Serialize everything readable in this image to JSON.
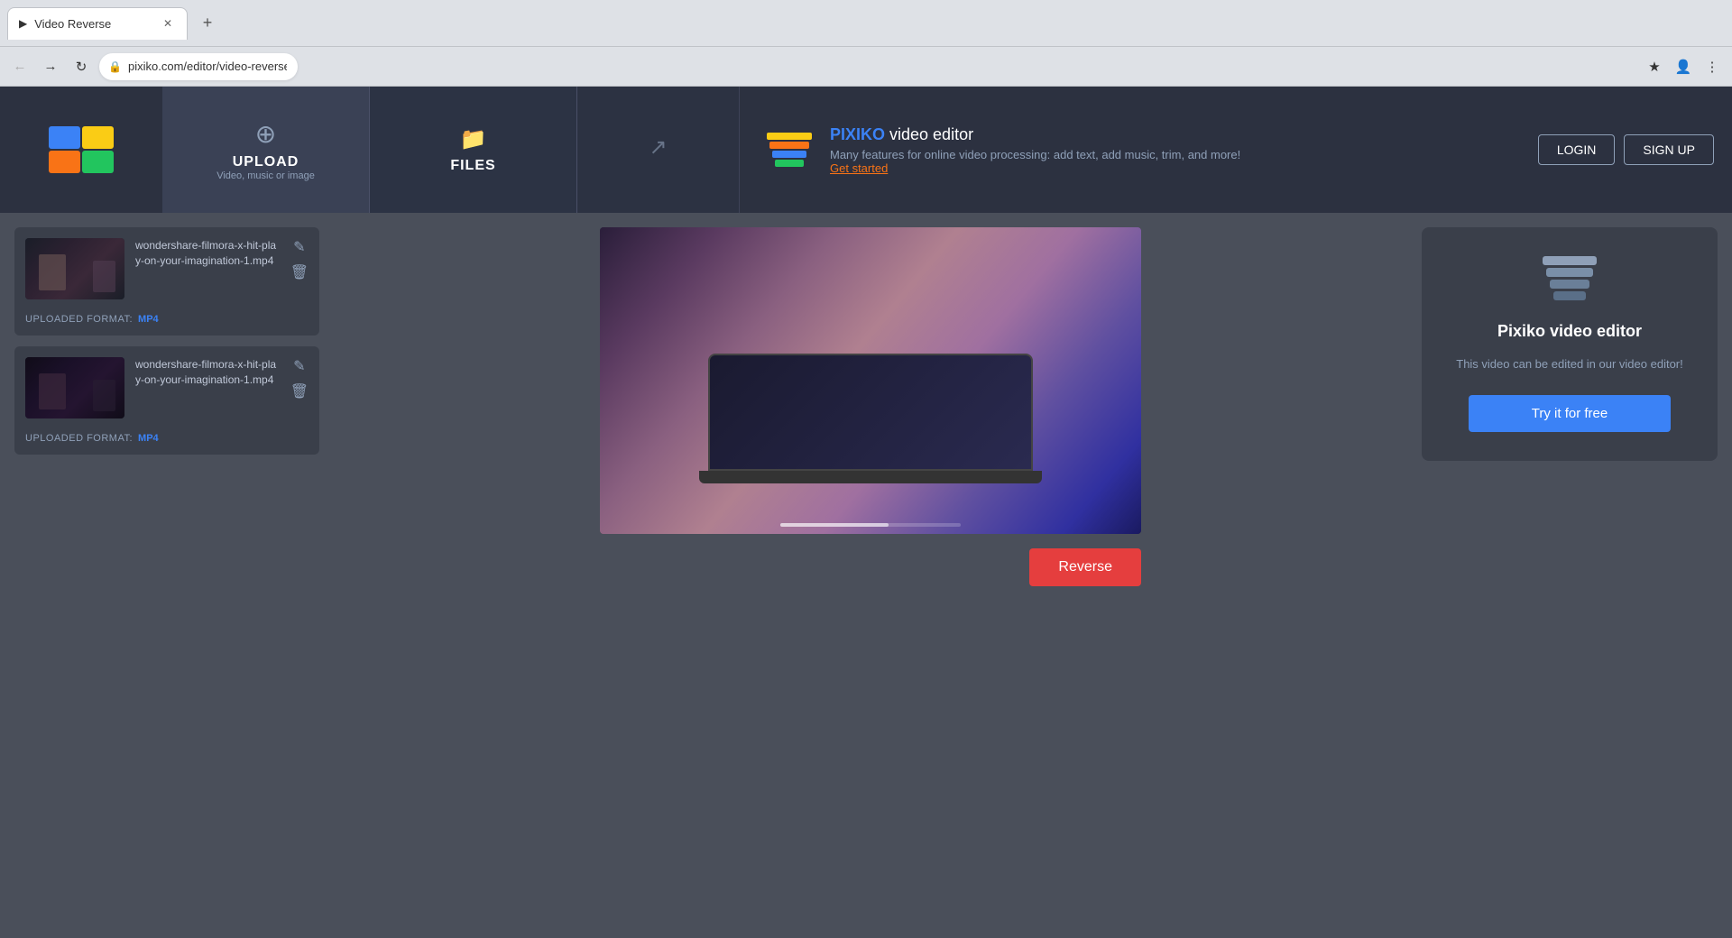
{
  "browser": {
    "tab_title": "Video Reverse",
    "address": "pixiko.com/editor/video-reverse",
    "favicon": "▶"
  },
  "header": {
    "upload_label": "UPLOAD",
    "upload_sublabel": "Video, music or image",
    "files_label": "FILES",
    "promo_brand": "PIXIKO",
    "promo_title_rest": " video editor",
    "promo_desc": "Many features for online video processing: add text, add music, trim, and more!",
    "promo_link": "Get started",
    "login_label": "LOGIN",
    "signup_label": "SIGN UP"
  },
  "sidebar": {
    "file1": {
      "name": "wondershare-filmora-x-hit-play-on-your-imagination-1.mp4",
      "format_label": "UPLOADED FORMAT:",
      "format_value": "MP4"
    },
    "file2": {
      "name": "wondershare-filmora-x-hit-play-on-your-imagination-1.mp4",
      "format_label": "UPLOADED FORMAT:",
      "format_value": "MP4"
    }
  },
  "video": {
    "reverse_button": "Reverse"
  },
  "right_panel": {
    "editor_title": "Pixiko video editor",
    "editor_desc": "This video can be edited in our video editor!",
    "try_free_label": "Try it for free"
  }
}
